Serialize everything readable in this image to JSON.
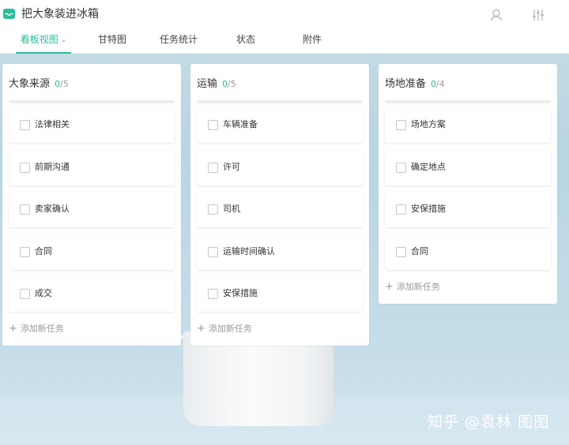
{
  "app": {
    "title": "把大象装进冰箱",
    "accent": "#2dbb9b",
    "icons": [
      "inbox-icon",
      "user-icon",
      "sliders-icon"
    ]
  },
  "tabs": [
    {
      "label": "看板视图",
      "active": true
    },
    {
      "label": "甘特图",
      "active": false
    },
    {
      "label": "任务统计",
      "active": false
    },
    {
      "label": "状态",
      "active": false
    },
    {
      "label": "附件",
      "active": false
    }
  ],
  "columns": [
    {
      "title": "大象来源",
      "done": "0",
      "total": "/5",
      "tasks": [
        "法律相关",
        "前期沟通",
        "卖家确认",
        "合同",
        "成交"
      ],
      "add_label": "添加新任务"
    },
    {
      "title": "运输",
      "done": "0",
      "total": "/5",
      "tasks": [
        "车辆准备",
        "许可",
        "司机",
        "运输时间确认",
        "安保措施"
      ],
      "add_label": "添加新任务"
    },
    {
      "title": "场地准备",
      "done": "0",
      "total": "/4",
      "tasks": [
        "场地方案",
        "确定地点",
        "安保措施",
        "合同"
      ],
      "add_label": "添加新任务"
    }
  ],
  "watermark": "知乎 @袁林 图图"
}
